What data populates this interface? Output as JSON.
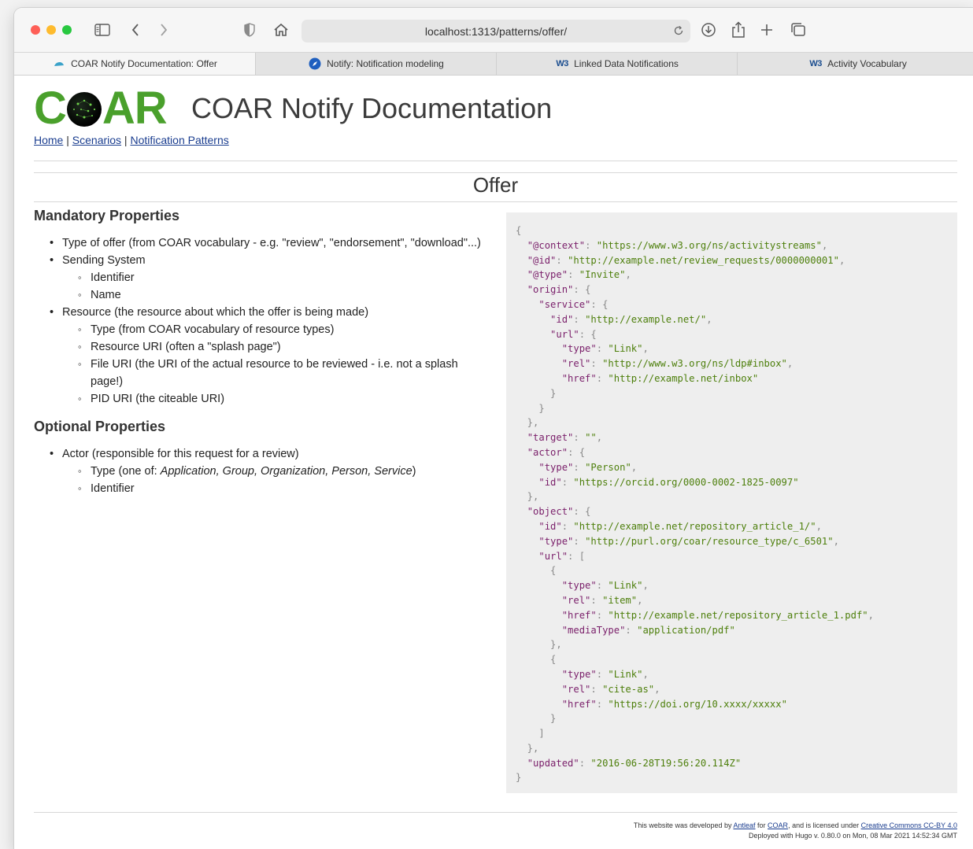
{
  "browser": {
    "url": "localhost:1313/patterns/offer/",
    "tabs": [
      {
        "label": "COAR Notify Documentation: Offer",
        "icon": "coar-favicon-icon",
        "active": true
      },
      {
        "label": "Notify: Notification modeling",
        "icon": "compass-favicon-icon",
        "active": false
      },
      {
        "label": "Linked Data Notifications",
        "icon": "w3c-favicon-icon",
        "active": false
      },
      {
        "label": "Activity Vocabulary",
        "icon": "w3c-favicon-icon",
        "active": false
      }
    ],
    "w3_glyph": "W3"
  },
  "header": {
    "logo_left": "C",
    "logo_right": "AR",
    "site_title": "COAR Notify Documentation",
    "nav": [
      "Home",
      "Scenarios",
      "Notification Patterns"
    ],
    "nav_separator": " | "
  },
  "page": {
    "title": "Offer",
    "mandatory_heading": "Mandatory Properties",
    "mandatory": {
      "item1": "Type of offer (from COAR vocabulary - e.g. \"review\", \"endorsement\", \"download\"...)",
      "item2": "Sending System",
      "item2_sub1": "Identifier",
      "item2_sub2": "Name",
      "item3": "Resource (the resource about which the offer is being made)",
      "item3_sub1": "Type (from COAR vocabulary of resource types)",
      "item3_sub2": "Resource URI (often a \"splash page\")",
      "item3_sub3": "File URI (the URI of the actual resource to be reviewed - i.e. not a splash page!)",
      "item3_sub4": "PID URI (the citeable URI)"
    },
    "optional_heading": "Optional Properties",
    "optional": {
      "item1": "Actor (responsible for this request for a review)",
      "sub1_prefix": "Type (one of: ",
      "sub1_italic": "Application, Group, Organization, Person, Service",
      "sub1_suffix": ")",
      "sub2": "Identifier"
    }
  },
  "code": {
    "context": "https://www.w3.org/ns/activitystreams",
    "id": "http://example.net/review_requests/0000000001",
    "type": "Invite",
    "origin_service_id": "http://example.net/",
    "origin_url_type": "Link",
    "origin_url_rel": "http://www.w3.org/ns/ldp#inbox",
    "origin_url_href": "http://example.net/inbox",
    "target": "",
    "actor_type": "Person",
    "actor_id": "https://orcid.org/0000-0002-1825-0097",
    "object_id": "http://example.net/repository_article_1/",
    "object_type": "http://purl.org/coar/resource_type/c_6501",
    "url1_type": "Link",
    "url1_rel": "item",
    "url1_href": "http://example.net/repository_article_1.pdf",
    "url1_mediaType": "application/pdf",
    "url2_type": "Link",
    "url2_rel": "cite-as",
    "url2_href": "https://doi.org/10.xxxx/xxxxx",
    "updated": "2016-06-28T19:56:20.114Z"
  },
  "footer": {
    "line1_a": "This website was developed by ",
    "antleaf": "Antleaf",
    "line1_b": " for ",
    "coar": "COAR",
    "line1_c": ", and is licensed under ",
    "license": "Creative Commons CC-BY 4.0",
    "line2": "Deployed with Hugo v. 0.80.0 on Mon, 08 Mar 2021 14:52:34 GMT"
  }
}
